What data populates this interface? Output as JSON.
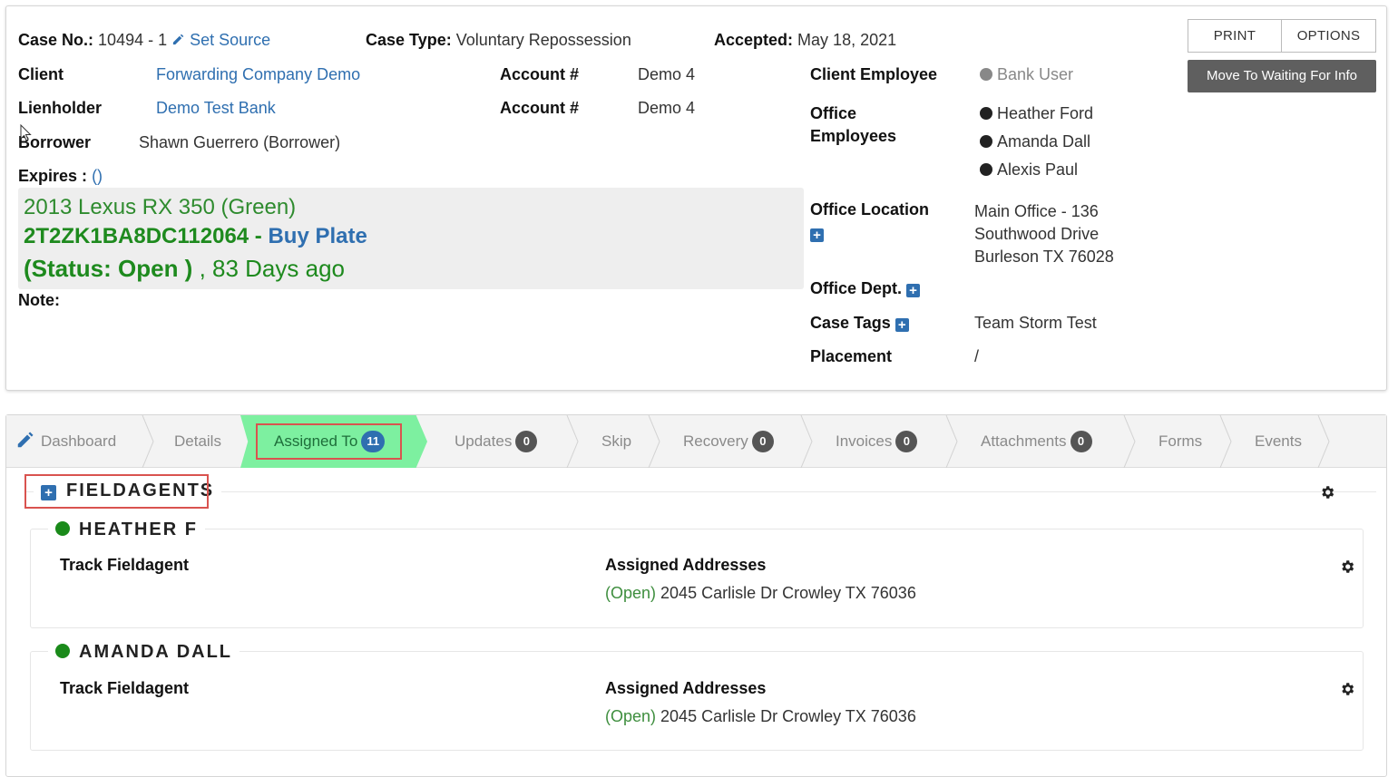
{
  "header": {
    "case_no_label": "Case No.:",
    "case_no_value": "10494 - 1",
    "set_source": "Set Source",
    "case_type_label": "Case Type:",
    "case_type_value": "Voluntary Repossession",
    "accepted_label": "Accepted:",
    "accepted_value": "May 18, 2021"
  },
  "actions": {
    "print": "PRINT",
    "options": "OPTIONS",
    "move": "Move To Waiting For Info"
  },
  "details": {
    "client_label": "Client",
    "client_value": "Forwarding Company Demo",
    "lienholder_label": "Lienholder",
    "lienholder_value": "Demo Test Bank",
    "borrower_label": "Borrower",
    "borrower_value": "Shawn Guerrero (Borrower)",
    "expires_label": "Expires :",
    "expires_value": "()",
    "account1_label": "Account #",
    "account1_value": "Demo 4",
    "account2_label": "Account #",
    "account2_value": "Demo 4",
    "note_label": "Note:"
  },
  "vehicle": {
    "description": "2013 Lexus RX 350 (Green)",
    "vin": "2T2ZK1BA8DC112064",
    "vin_sep": " - ",
    "buy_plate": "Buy Plate",
    "status": "(Status: Open )",
    "age": " , 83 Days ago"
  },
  "right_info": {
    "client_employee_label": "Client Employee",
    "client_employee_value": "Bank User",
    "office_employees_label_1": "Office",
    "office_employees_label_2": "Employees",
    "office_employees": [
      "Heather Ford",
      "Amanda Dall",
      "Alexis Paul"
    ],
    "office_location_label": "Office Location",
    "office_location_lines": [
      "Main Office - 136",
      "Southwood Drive",
      "Burleson TX 76028"
    ],
    "office_dept_label": "Office Dept.",
    "case_tags_label": "Case Tags",
    "case_tags_value": "Team Storm Test",
    "placement_label": "Placement",
    "placement_value": "/"
  },
  "tabs": [
    {
      "label": "Dashboard"
    },
    {
      "label": "Details"
    },
    {
      "label": "Assigned To",
      "count": "11"
    },
    {
      "label": "Updates",
      "count": "0"
    },
    {
      "label": "Skip"
    },
    {
      "label": "Recovery",
      "count": "0"
    },
    {
      "label": "Invoices",
      "count": "0"
    },
    {
      "label": "Attachments",
      "count": "0"
    },
    {
      "label": "Forms"
    },
    {
      "label": "Events"
    }
  ],
  "fieldagents": {
    "title": "FIELDAGENTS",
    "agents": [
      {
        "name": "HEATHER F",
        "track_label": "Track Fieldagent",
        "addresses_label": "Assigned Addresses",
        "status": "(Open)",
        "address": " 2045 Carlisle Dr Crowley TX 76036"
      },
      {
        "name": "AMANDA DALL",
        "track_label": "Track Fieldagent",
        "addresses_label": "Assigned Addresses",
        "status": "(Open)",
        "address": " 2045 Carlisle Dr Crowley TX 76036"
      }
    ]
  },
  "colors": {
    "link": "#2f6fb0",
    "active_tab": "#7df0a0",
    "highlight_box": "#d9534f",
    "vehicle_green": "#1e8a1e",
    "dark_button": "#5f5f5f"
  }
}
